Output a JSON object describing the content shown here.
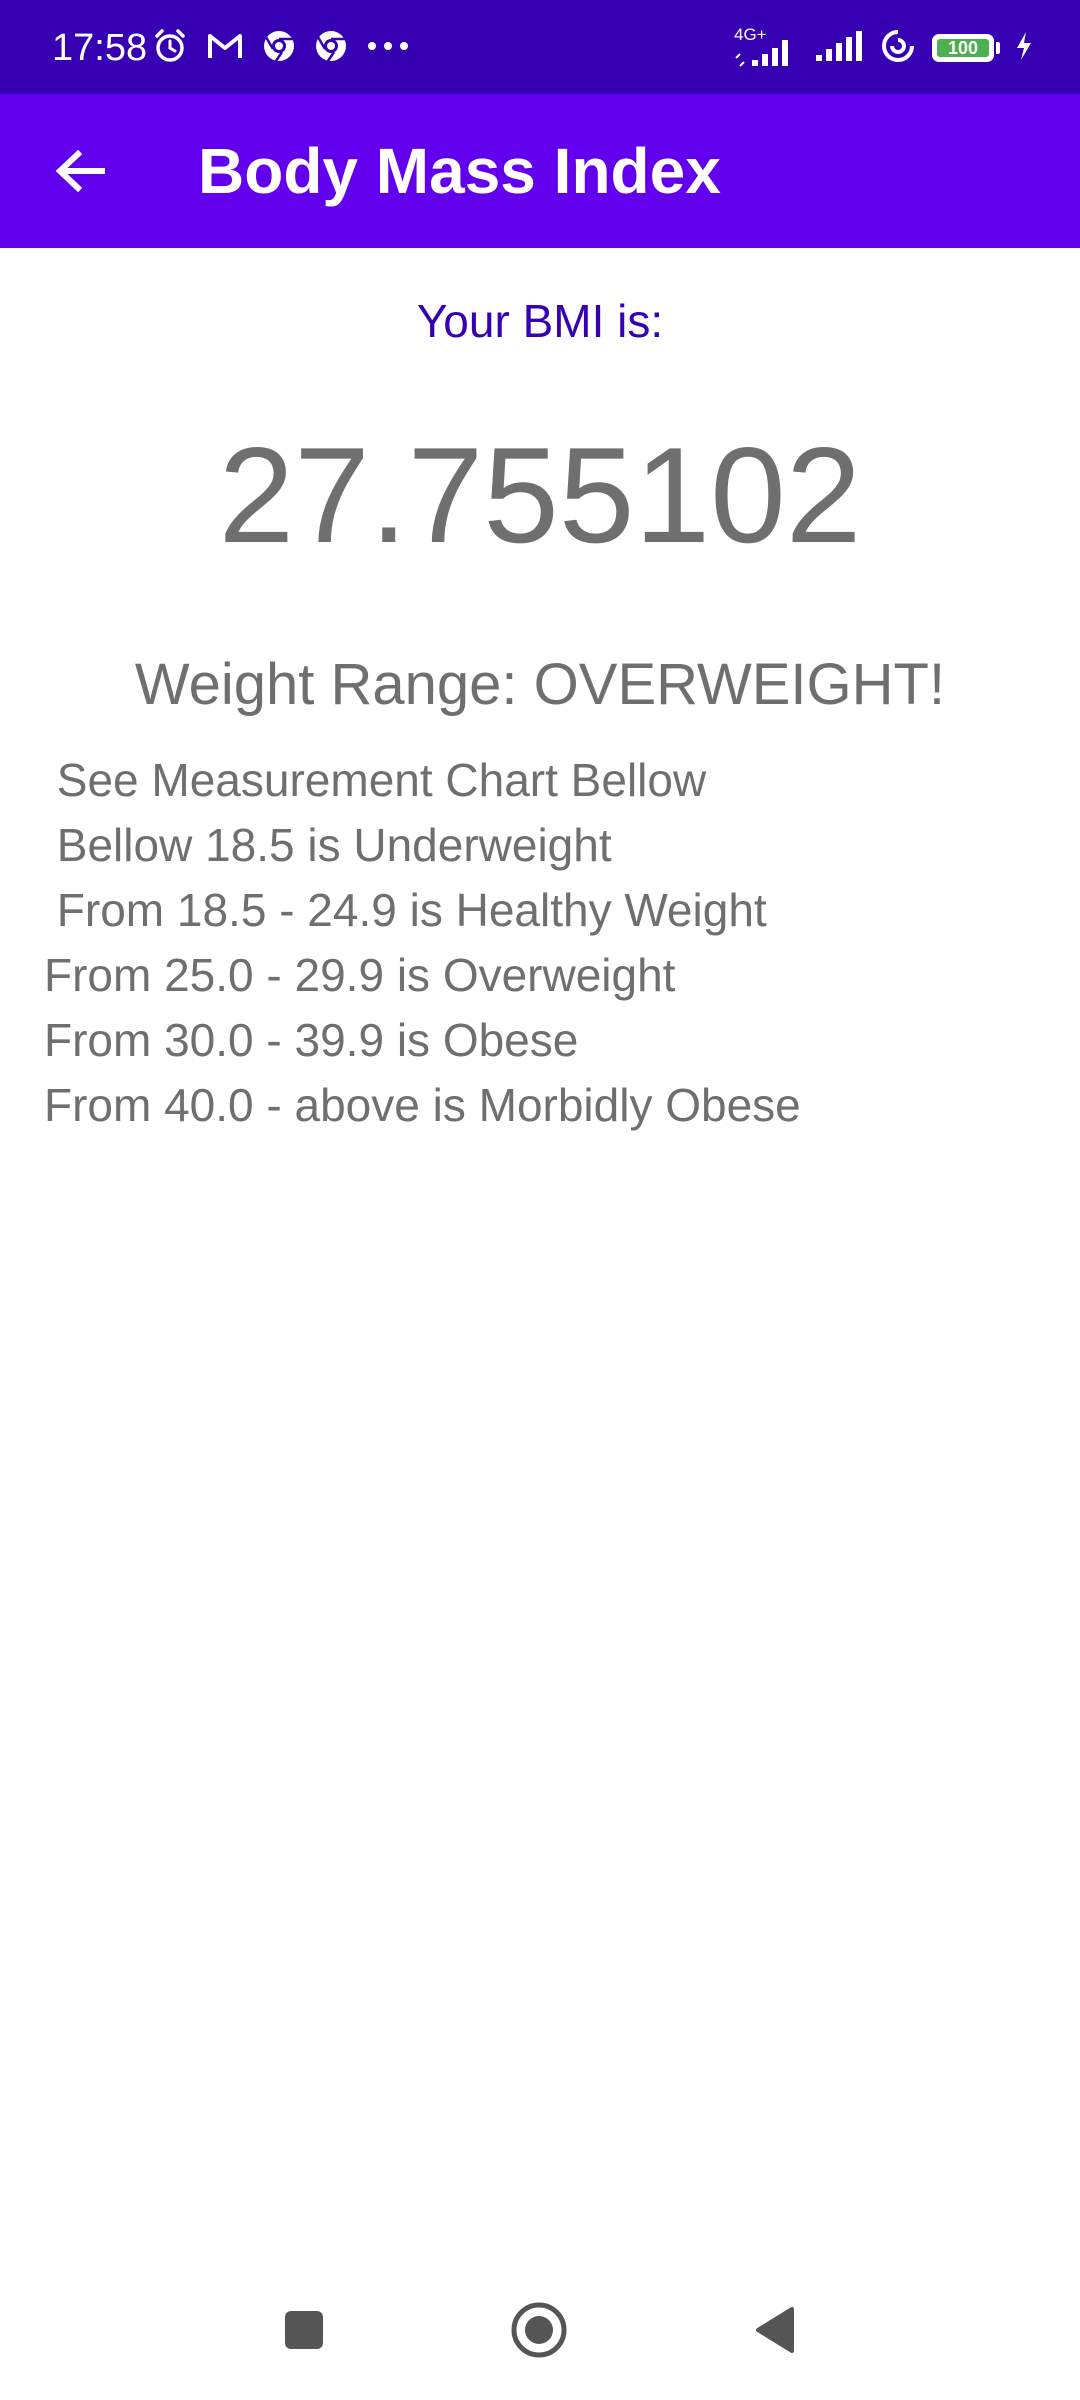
{
  "status_bar": {
    "time": "17:58",
    "left_icons": [
      "alarm-icon",
      "gmail-icon",
      "chrome-icon",
      "chrome-icon",
      "more-dots-icon"
    ],
    "network_label": "4G+",
    "battery_level": "100",
    "colors": {
      "background": "#3700b3",
      "battery_fill": "#4caf50"
    }
  },
  "app_bar": {
    "title": "Body Mass Index",
    "back_icon": "arrow-back-icon",
    "background": "#6200ee"
  },
  "result": {
    "label": "Your BMI is:",
    "value": "27.755102",
    "weight_range": "Weight Range: OVERWEIGHT!"
  },
  "chart": {
    "lines": [
      " See Measurement Chart Bellow",
      " Bellow 18.5 is Underweight",
      " From 18.5 - 24.9 is Healthy Weight",
      "From 25.0 - 29.9 is Overweight",
      "From 30.0 - 39.9 is Obese",
      "From 40.0 - above is Morbidly Obese"
    ]
  },
  "nav_bar": {
    "buttons": [
      "recents-square-icon",
      "home-circle-icon",
      "back-triangle-icon"
    ]
  }
}
